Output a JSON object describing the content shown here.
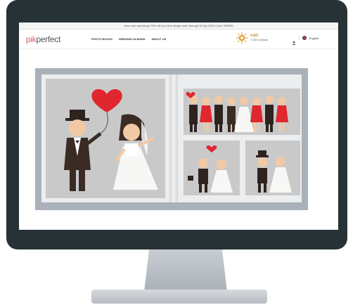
{
  "promo": {
    "text": "New user special get 20% off your first design store through 30 july 2020   Code: NEW20"
  },
  "brand": {
    "part1": "pik",
    "part2": "perfect"
  },
  "nav": {
    "items": [
      "PHOTO BOOKS",
      "WEDDING ALBUMS",
      "ABOUT US"
    ]
  },
  "rating": {
    "value": "4.8/5",
    "caption": "7,252 reviews"
  },
  "lang": {
    "label": "English"
  },
  "colors": {
    "accent": "#e8595a",
    "bezel": "#263235",
    "album": "#aab1b8"
  }
}
